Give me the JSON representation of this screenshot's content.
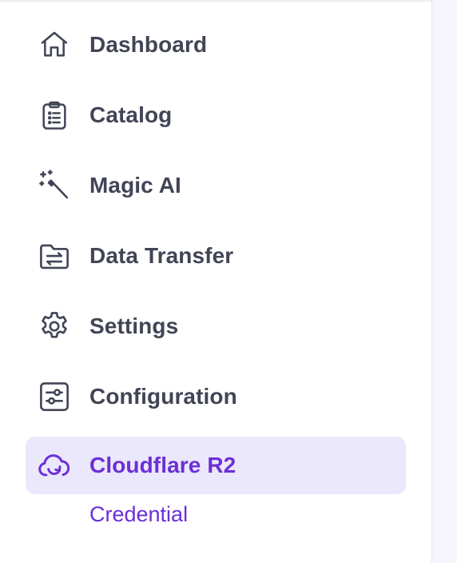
{
  "sidebar": {
    "items": [
      {
        "label": "Dashboard",
        "icon": "home-icon"
      },
      {
        "label": "Catalog",
        "icon": "clipboard-list-icon"
      },
      {
        "label": "Magic AI",
        "icon": "magic-wand-icon"
      },
      {
        "label": "Data Transfer",
        "icon": "folder-transfer-icon"
      },
      {
        "label": "Settings",
        "icon": "gear-icon"
      },
      {
        "label": "Configuration",
        "icon": "sliders-icon"
      },
      {
        "label": "Cloudflare R2",
        "icon": "cloud-icon",
        "active": true
      }
    ],
    "subitems": [
      {
        "label": "Credential"
      }
    ]
  },
  "colors": {
    "text": "#414555",
    "accent": "#6b2fd6",
    "active_bg": "#ebe7fc"
  }
}
